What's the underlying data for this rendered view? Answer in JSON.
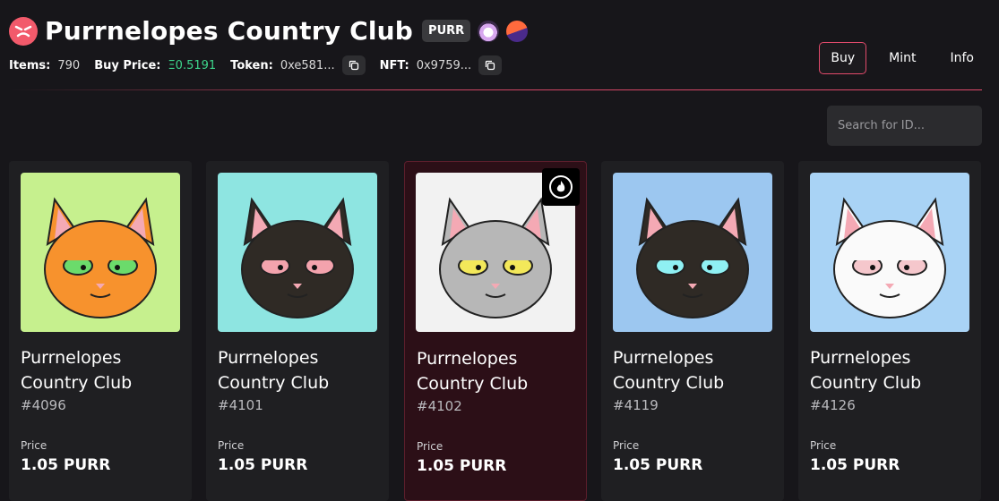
{
  "header": {
    "title": "Purrnelopes Country Club",
    "ticker": "PURR",
    "logo_icon": "angry-cat-face-icon",
    "market_icons": [
      "marketplace-eye-icon",
      "marketplace-orb-icon"
    ]
  },
  "stats": {
    "items_label": "Items:",
    "items_value": "790",
    "buy_price_label": "Buy Price:",
    "buy_price_value": "Ξ0.5191",
    "token_label": "Token:",
    "token_value": "0xe581...",
    "nft_label": "NFT:",
    "nft_value": "0x9759..."
  },
  "nav": {
    "buy": "Buy",
    "mint": "Mint",
    "info": "Info"
  },
  "search": {
    "placeholder": "Search for ID..."
  },
  "cards": [
    {
      "name": "Purrnelopes Country Club",
      "id": "#4096",
      "price_label": "Price",
      "price": "1.05 PURR",
      "bg": "#c6f08e",
      "fur": "#f7922d",
      "eyes": "#6bdb6b"
    },
    {
      "name": "Purrnelopes Country Club",
      "id": "#4101",
      "price_label": "Price",
      "price": "1.05 PURR",
      "bg": "#8ee5e1",
      "fur": "#2f2a25",
      "eyes": "#f3a3ad"
    },
    {
      "name": "Purrnelopes Country Club",
      "id": "#4102",
      "price_label": "Price",
      "price": "1.05 PURR",
      "bg": "#f2f2f2",
      "fur": "#b7b7b7",
      "eyes": "#f3e85a"
    },
    {
      "name": "Purrnelopes Country Club",
      "id": "#4119",
      "price_label": "Price",
      "price": "1.05 PURR",
      "bg": "#9cc7f0",
      "fur": "#2f2a25",
      "eyes": "#8ff0f3"
    },
    {
      "name": "Purrnelopes Country Club",
      "id": "#4126",
      "price_label": "Price",
      "price": "1.05 PURR",
      "bg": "#a9d3f5",
      "fur": "#fafafa",
      "eyes": "#f5c7cc"
    }
  ]
}
